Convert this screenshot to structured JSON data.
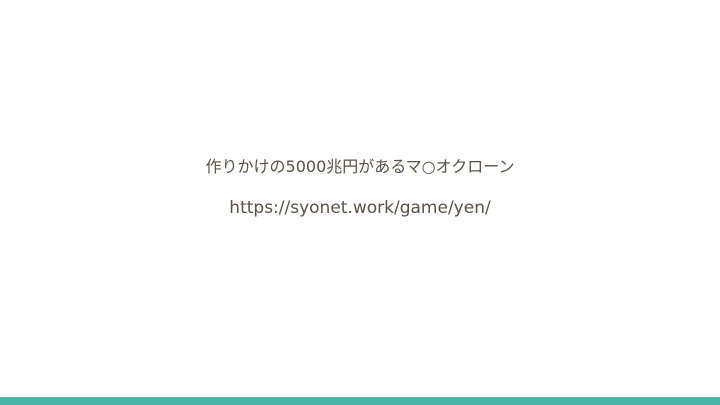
{
  "slide": {
    "title": "作りかけの5000兆円があるマ○オクローン",
    "url": "https://syonet.work/game/yen/"
  },
  "colors": {
    "text": "#5b5247",
    "accent_bar": "#4db3a8",
    "background": "#ffffff"
  }
}
